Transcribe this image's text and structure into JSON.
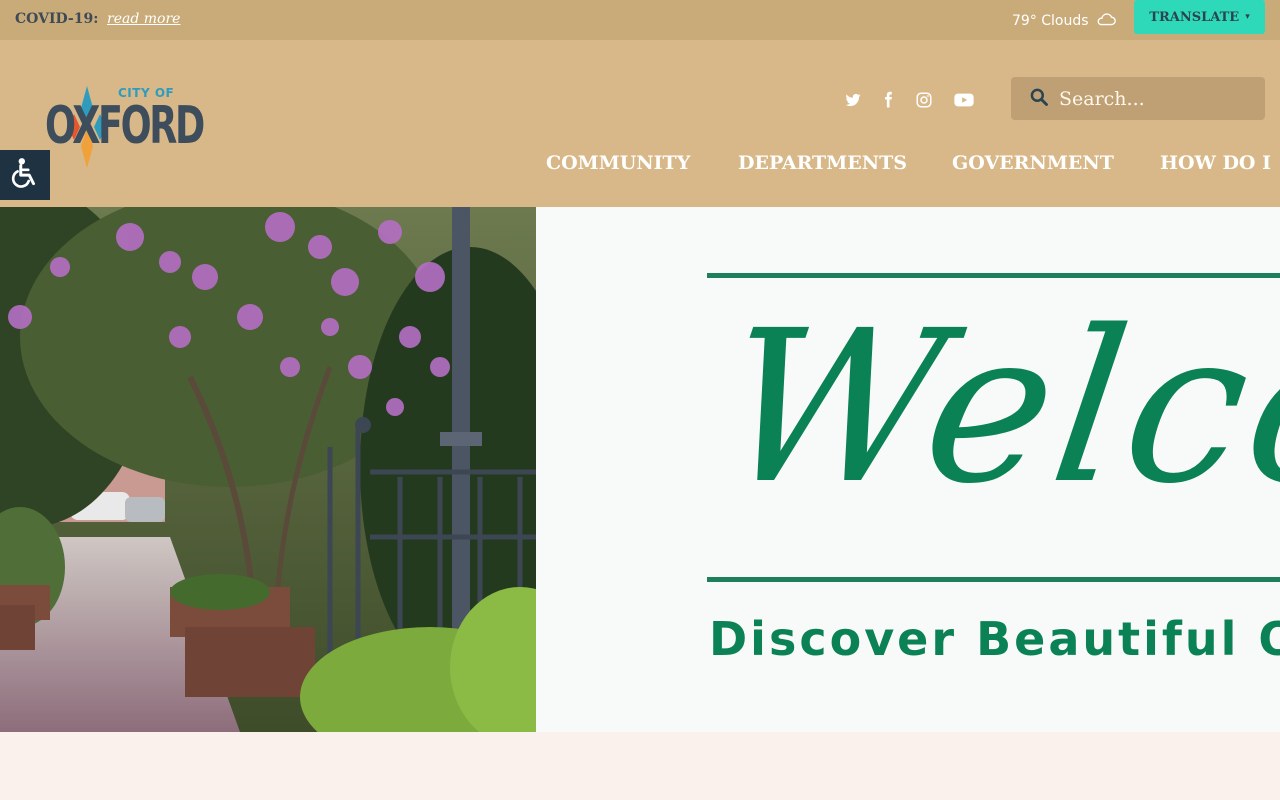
{
  "alert": {
    "label": "COVID-19:",
    "link": "read more"
  },
  "weather": {
    "text": "79° Clouds",
    "icon": "cloud-icon"
  },
  "translate": {
    "label": "TRANSLATE",
    "icon": "chevron-down-icon"
  },
  "logo": {
    "top_text": "CITY OF",
    "wordmark": "OXFORD"
  },
  "social": [
    "twitter-icon",
    "facebook-icon",
    "instagram-icon",
    "youtube-icon"
  ],
  "search": {
    "placeholder": "Search..."
  },
  "nav": {
    "items": [
      "COMMUNITY",
      "DEPARTMENTS",
      "GOVERNMENT",
      "HOW DO I"
    ]
  },
  "side": {
    "accessibility_icon": "wheelchair-icon",
    "share_icon": "share-icon"
  },
  "hero": {
    "script": "Welcom",
    "subtitle": "Discover Beautiful Ox"
  },
  "colors": {
    "alert_bar": "#c9ab7a",
    "header": "#d8b888",
    "translate": "#2ed9b9",
    "accent_green": "#0b8255",
    "page_bg": "#faf1ec"
  }
}
